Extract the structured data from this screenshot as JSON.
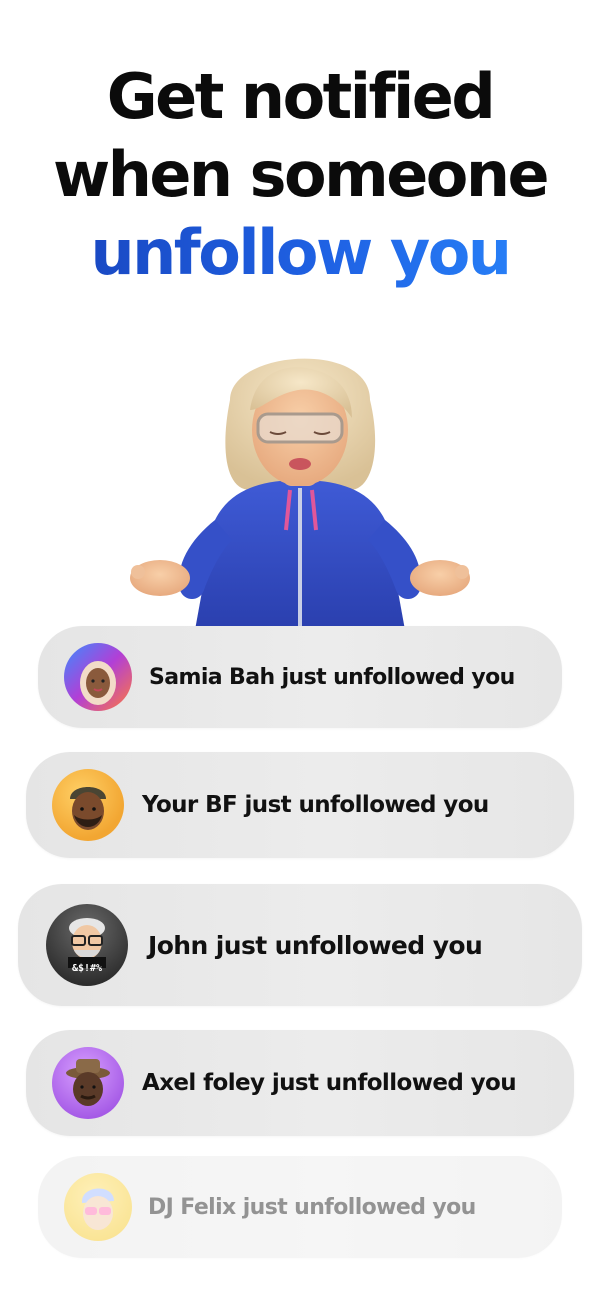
{
  "headline": {
    "line1": "Get notified",
    "line2": "when someone",
    "line3": "unfollow you"
  },
  "hero": {
    "icon": "memoji-woman-meditating-icon"
  },
  "notifications": [
    {
      "message": "Samia Bah just unfollowed you",
      "avatar_icon": "memoji-woman-hijab-icon",
      "avatar_bg": "#b040d8"
    },
    {
      "message": "Your BF just unfollowed you",
      "avatar_icon": "memoji-man-beanie-icon",
      "avatar_bg": "#f2a632"
    },
    {
      "message": "John just unfollowed you",
      "avatar_icon": "memoji-man-glasses-icon",
      "avatar_bg": "#3a3a3a",
      "avatar_badge": "&$!#%"
    },
    {
      "message": "Axel foley just unfollowed you",
      "avatar_icon": "memoji-man-hat-icon",
      "avatar_bg": "#b060e8"
    },
    {
      "message": "DJ Felix just unfollowed you",
      "avatar_icon": "memoji-sunglasses-icon",
      "avatar_bg": "#f5c518"
    }
  ]
}
